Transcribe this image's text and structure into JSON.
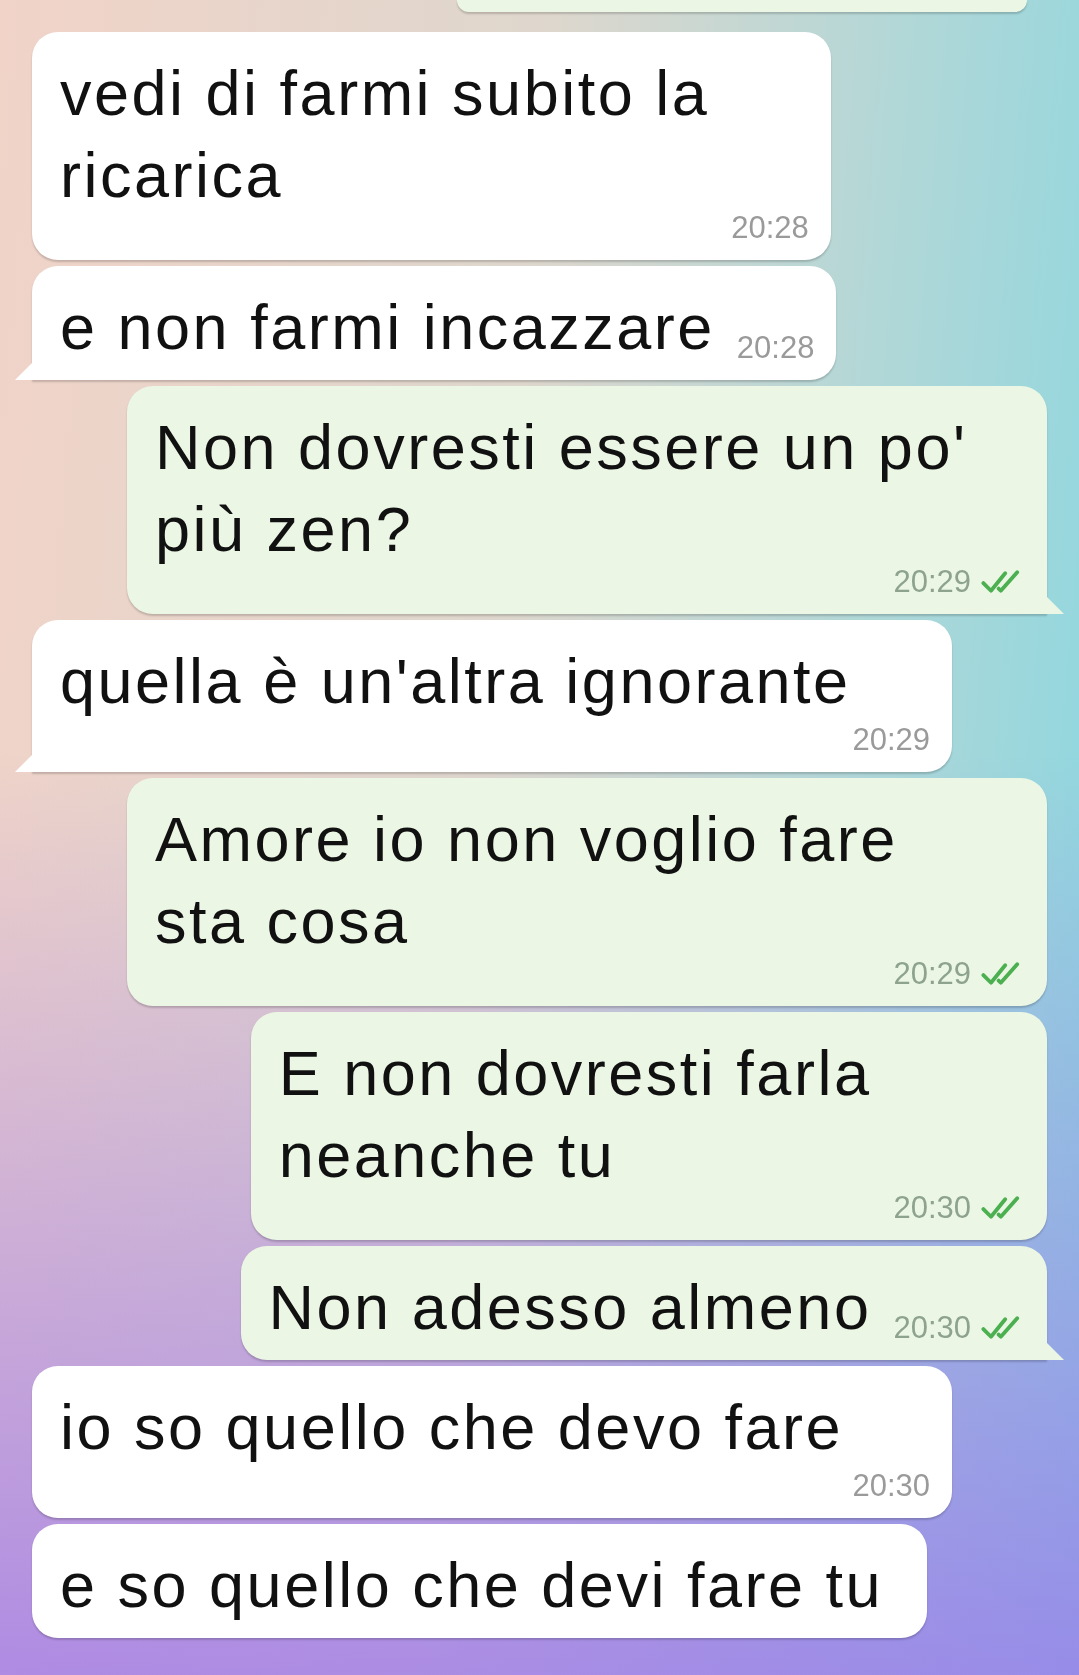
{
  "messages": [
    {
      "kind": "outgoing",
      "clipped_top": true
    },
    {
      "kind": "incoming",
      "text": "vedi di farmi subito la\nricarica",
      "time": "20:28",
      "tail": false
    },
    {
      "kind": "incoming",
      "text": "e non farmi incazzare",
      "time": "20:28",
      "tail": true
    },
    {
      "kind": "outgoing",
      "text": "Non dovresti essere un po'\npiù zen?",
      "time": "20:29",
      "read": true,
      "tail": true
    },
    {
      "kind": "incoming",
      "text": "quella è un'altra ignorante",
      "time": "20:29",
      "tail": true
    },
    {
      "kind": "outgoing",
      "text": "Amore io non voglio fare\nsta cosa",
      "time": "20:29",
      "read": true,
      "tail": false
    },
    {
      "kind": "outgoing",
      "text": "E non dovresti farla\nneanche tu",
      "time": "20:30",
      "read": true,
      "tail": false
    },
    {
      "kind": "outgoing",
      "text": "Non adesso almeno",
      "time": "20:30",
      "read": true,
      "tail": true
    },
    {
      "kind": "incoming",
      "text": "io so quello che devo fare",
      "time": "20:30",
      "tail": false
    },
    {
      "kind": "incoming",
      "text": "e so quello che devi fare tu",
      "tail": false
    }
  ]
}
